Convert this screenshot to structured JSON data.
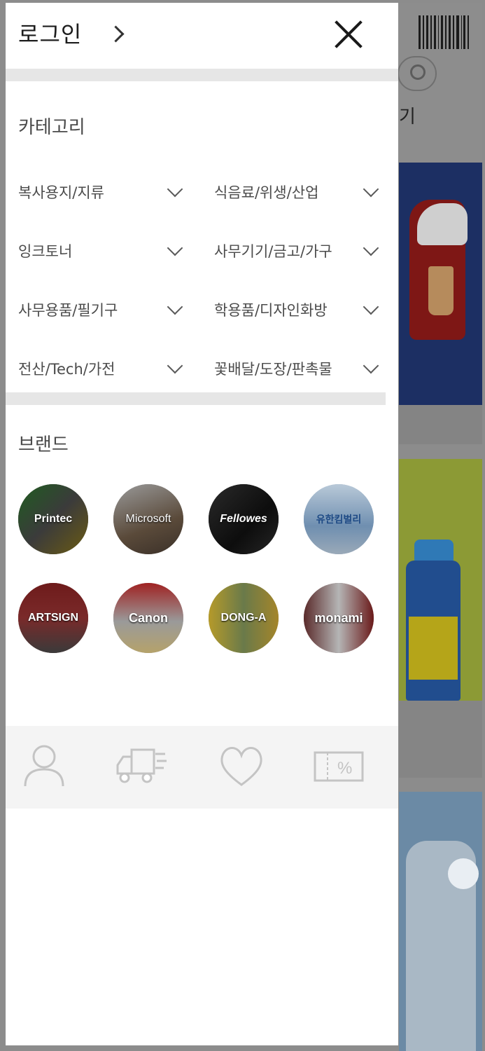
{
  "drawer": {
    "login_label": "로그인",
    "category_title": "카테고리",
    "categories": [
      "복사용지/지류",
      "식음료/위생/산업",
      "잉크토너",
      "사무기기/금고/가구",
      "사무용품/필기구",
      "학용품/디자인화방",
      "전산/Tech/가전",
      "꽃배달/도장/판촉물"
    ],
    "brand_title": "브랜드",
    "brands": [
      "Printec",
      "Microsoft",
      "Fellowes",
      "유한킴벌리",
      "ARTSIGN",
      "Canon",
      "DONG-A",
      "monami"
    ]
  },
  "background_page": {
    "partial_text": "기"
  },
  "colors": {
    "drawer_bg": "#ffffff",
    "divider": "#e6e6e6",
    "overlay": "#8c8c8c",
    "quick_bar_bg": "#f4f4f4",
    "icon_gray": "#c4c4c4"
  },
  "icons": [
    "user-icon",
    "delivery-truck-icon",
    "heart-icon",
    "coupon-icon"
  ]
}
